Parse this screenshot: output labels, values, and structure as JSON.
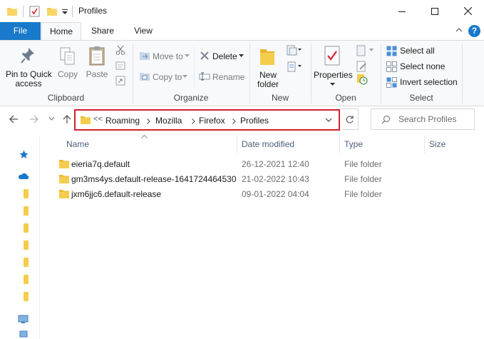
{
  "window": {
    "title": "Profiles"
  },
  "ribbon_tabs": {
    "file": "File",
    "home": "Home",
    "share": "Share",
    "view": "View",
    "help": "?"
  },
  "ribbon": {
    "clipboard": {
      "pin_line1": "Pin to Quick",
      "pin_line2": "access",
      "copy": "Copy",
      "paste": "Paste",
      "group": "Clipboard"
    },
    "organize": {
      "move_to": "Move to",
      "copy_to": "Copy to",
      "delete": "Delete",
      "rename": "Rename",
      "group": "Organize"
    },
    "new": {
      "new_folder_line1": "New",
      "new_folder_line2": "folder",
      "group": "New"
    },
    "open": {
      "properties": "Properties",
      "group": "Open"
    },
    "select": {
      "select_all": "Select all",
      "select_none": "Select none",
      "invert_selection": "Invert selection",
      "group": "Select"
    }
  },
  "address": {
    "overflow": "<<",
    "parts": [
      "Roaming",
      "Mozilla",
      "Firefox",
      "Profiles"
    ],
    "highlight_color": "#d2202f"
  },
  "search": {
    "placeholder": "Search Profiles"
  },
  "columns": {
    "name": "Name",
    "date": "Date modified",
    "type": "Type",
    "size": "Size"
  },
  "files": [
    {
      "name": "eieria7q.default",
      "date": "26-12-2021 12:40",
      "type": "File folder",
      "size": ""
    },
    {
      "name": "gm3ms4ys.default-release-1641724464530",
      "date": "21-02-2022 10:43",
      "type": "File folder",
      "size": ""
    },
    {
      "name": "jxm6jjc6.default-release",
      "date": "09-01-2022 04:04",
      "type": "File folder",
      "size": ""
    }
  ],
  "colors": {
    "accent": "#1979ca",
    "folder": "#f5cd4d",
    "header_text": "#4c607a"
  }
}
